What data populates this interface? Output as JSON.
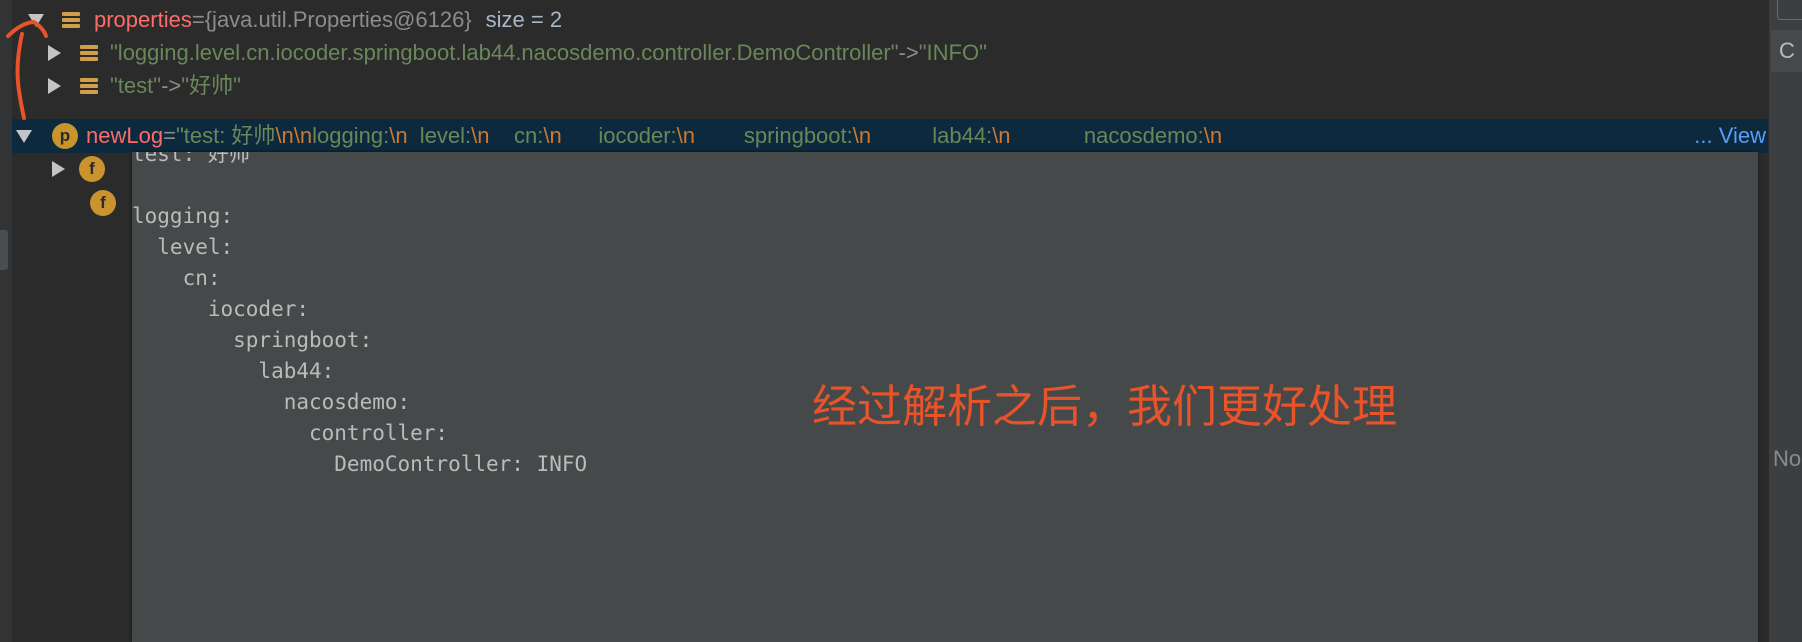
{
  "rows": {
    "properties": {
      "name": "properties",
      "eq": " = ",
      "value": "{java.util.Properties@6126}",
      "size": "size = 2"
    },
    "entry1": {
      "key": "\"logging.level.cn.iocoder.springboot.lab44.nacosdemo.controller.DemoController\"",
      "arrow": " -> ",
      "value": "\"INFO\""
    },
    "entry2": {
      "key": "\"test\"",
      "arrow": " -> ",
      "value": "\"好帅\""
    },
    "newlog": {
      "badge": "p",
      "name": "newLog",
      "eq": " = ",
      "segments": [
        {
          "t": "\"test: 好帅",
          "k": "str"
        },
        {
          "t": "\\n\\n",
          "k": "esc"
        },
        {
          "t": "logging:",
          "k": "str"
        },
        {
          "t": "\\n",
          "k": "esc"
        },
        {
          "t": "  level:",
          "k": "str"
        },
        {
          "t": "\\n",
          "k": "esc"
        },
        {
          "t": "    cn:",
          "k": "str"
        },
        {
          "t": "\\n",
          "k": "esc"
        },
        {
          "t": "      iocoder:",
          "k": "str"
        },
        {
          "t": "\\n",
          "k": "esc"
        },
        {
          "t": "        springboot:",
          "k": "str"
        },
        {
          "t": "\\n",
          "k": "esc"
        },
        {
          "t": "          lab44:",
          "k": "str"
        },
        {
          "t": "\\n",
          "k": "esc"
        },
        {
          "t": "            nacosdemo:",
          "k": "str"
        },
        {
          "t": "\\n",
          "k": "esc"
        }
      ],
      "view_link": "... View"
    },
    "child1_badge": "f",
    "child2_badge": "f"
  },
  "popup": {
    "lines": [
      "test: 好帅",
      "",
      "logging:",
      "  level:",
      "    cn:",
      "      iocoder:",
      "        springboot:",
      "          lab44:",
      "            nacosdemo:",
      "              controller:",
      "                DemoController: INFO"
    ]
  },
  "annotation": "经过解析之后，我们更好处理",
  "right_panel": {
    "tab_letter": "C",
    "partial_text": "No"
  },
  "colors": {
    "background": "#2b2b2b",
    "selection": "#0d293e",
    "var_name": "#ff6b68",
    "string": "#6a8759",
    "escape": "#cc7832",
    "annotation": "#e8532a",
    "popup_bg": "#45494a"
  }
}
